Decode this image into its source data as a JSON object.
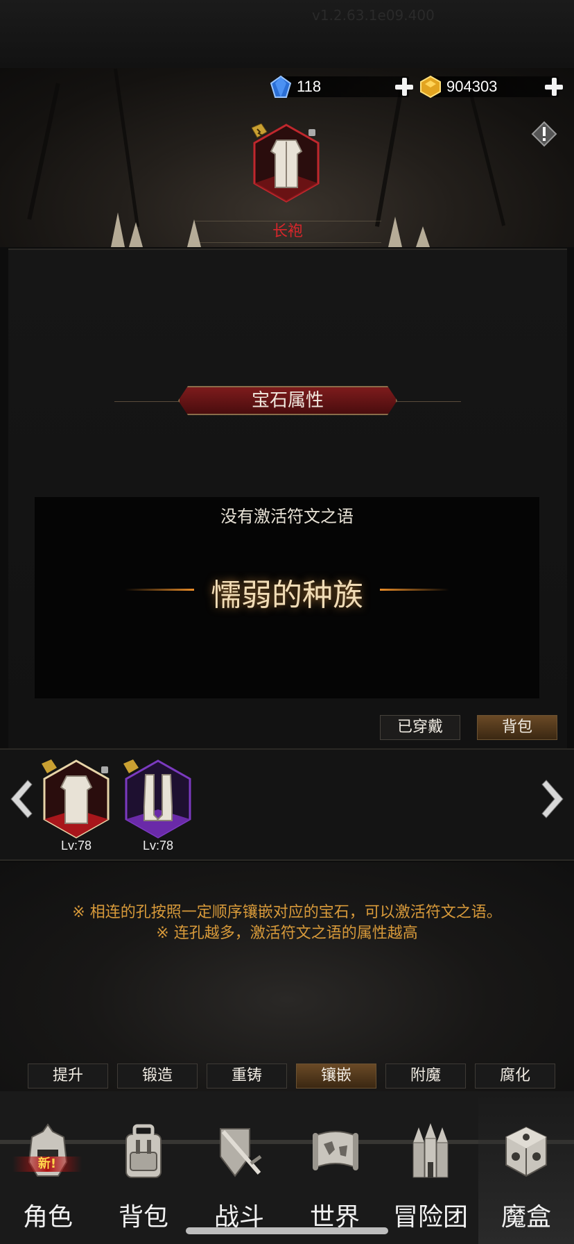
{
  "header": {
    "version": "v1.2.63.1e09.400",
    "currency": [
      {
        "icon": "blue-gem-icon",
        "value": "118"
      },
      {
        "icon": "gold-ingot-icon",
        "value": "904303"
      }
    ]
  },
  "equipment": {
    "name": "长袍"
  },
  "gem_panel": {
    "title": "宝石属性",
    "rune_status": "没有激活符文之语",
    "rune_word": "懦弱的种族"
  },
  "tabs": {
    "equipped": "已穿戴",
    "backpack": "背包"
  },
  "inventory": {
    "items": [
      {
        "icon": "robe-icon",
        "level": "Lv:78",
        "rarity_color": "#c0272d"
      },
      {
        "icon": "boots-icon",
        "level": "Lv:78",
        "rarity_color": "#7b3ac0"
      }
    ]
  },
  "tips": [
    "※ 相连的孔按照一定顺序镶嵌对应的宝石，可以激活符文之语。",
    "※ 连孔越多，激活符文之语的属性越高"
  ],
  "actions": [
    "提升",
    "锻造",
    "重铸",
    "镶嵌",
    "附魔",
    "腐化"
  ],
  "active_action": "镶嵌",
  "nav": {
    "items": [
      {
        "label": "角色",
        "icon": "helmet-icon",
        "badge": "新!"
      },
      {
        "label": "背包",
        "icon": "backpack-icon"
      },
      {
        "label": "战斗",
        "icon": "shield-sword-icon"
      },
      {
        "label": "世界",
        "icon": "map-scroll-icon"
      },
      {
        "label": "冒险团",
        "icon": "castle-icon"
      },
      {
        "label": "魔盒",
        "icon": "magic-cube-icon"
      }
    ],
    "active": "魔盒"
  },
  "colors": {
    "item_name": "#d8262b",
    "tip_text": "#d89a3a",
    "accent_bronze": "#6a4a26",
    "rune_glow": "#f1dcb6"
  }
}
